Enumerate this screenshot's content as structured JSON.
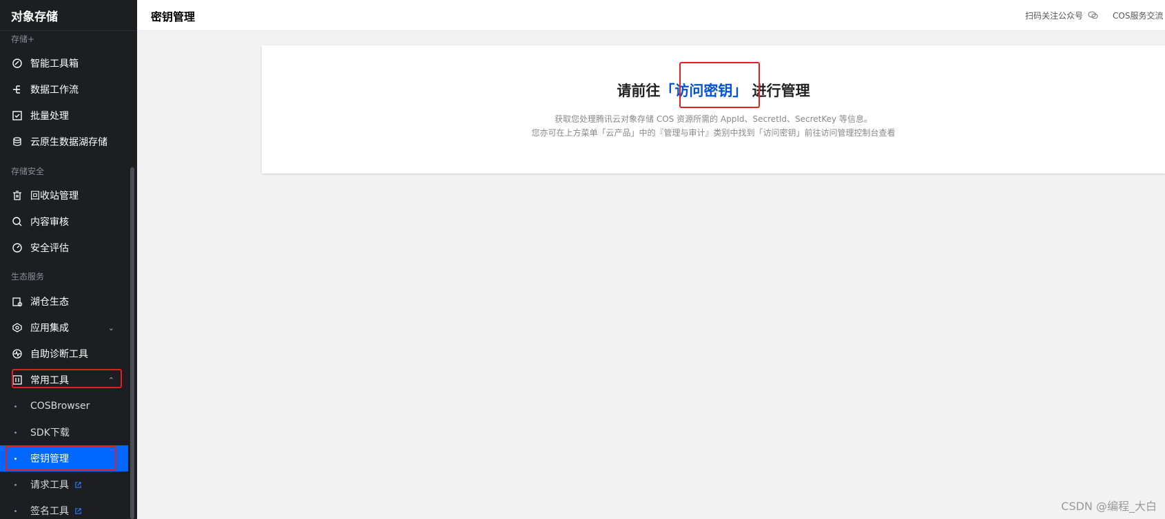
{
  "sidebar": {
    "title": "对象存储",
    "sections": {
      "storage_plus": "存储+",
      "storage_security": "存储安全",
      "ecosystem": "生态服务"
    },
    "items": [
      {
        "label": "智能工具箱",
        "icon": "toolbox-icon"
      },
      {
        "label": "数据工作流",
        "icon": "workflow-icon"
      },
      {
        "label": "批量处理",
        "icon": "checkbox-icon"
      },
      {
        "label": "云原生数据湖存储",
        "icon": "database-icon"
      },
      {
        "label": "回收站管理",
        "icon": "trash-icon"
      },
      {
        "label": "内容审核",
        "icon": "review-icon"
      },
      {
        "label": "安全评估",
        "icon": "gauge-icon"
      },
      {
        "label": "湖仓生态",
        "icon": "lakehouse-icon"
      },
      {
        "label": "应用集成",
        "icon": "integration-icon"
      },
      {
        "label": "自助诊断工具",
        "icon": "pulse-icon"
      },
      {
        "label": "常用工具",
        "icon": "wrench-icon"
      }
    ],
    "sub_items": [
      {
        "label": "COSBrowser"
      },
      {
        "label": "SDK下载"
      },
      {
        "label": "密钥管理",
        "active": true
      },
      {
        "label": "请求工具",
        "external": true
      },
      {
        "label": "签名工具",
        "external": true
      }
    ]
  },
  "header": {
    "page_title": "密钥管理",
    "wechat_link": "扫码关注公众号",
    "community_link": "COS服务交流"
  },
  "main": {
    "headline_before": "请前往",
    "headline_link": "「访问密钥」",
    "headline_after": "进行管理",
    "desc_line1": "获取您处理腾讯云对象存储 COS 资源所需的 AppId、SecretId、SecretKey 等信息。",
    "desc_line2": "您亦可在上方菜单「云产品」中的『管理与审计』类别中找到「访问密钥」前往访问管理控制台查看"
  },
  "watermark": "CSDN @编程_大白",
  "colors": {
    "sidebar_bg": "#1c1e21",
    "active": "#0067ff",
    "link": "#0052d9",
    "highlight": "#e02020"
  }
}
